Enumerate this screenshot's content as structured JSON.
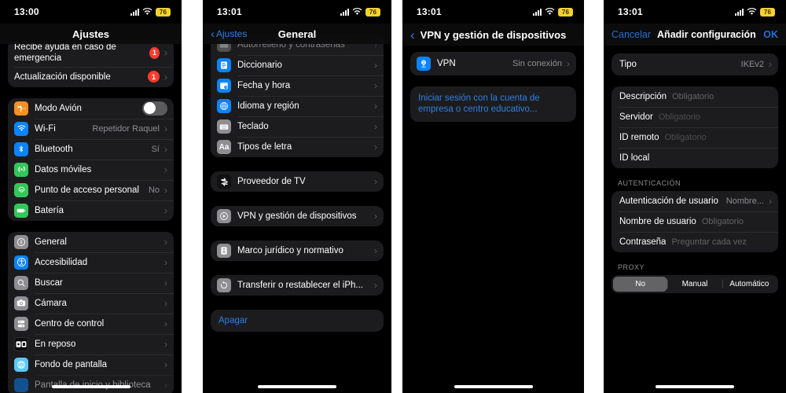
{
  "meta": {
    "accent_blue": "#2f7fe0",
    "badge_red": "#ff3b30",
    "group_bg": "#1c1c1e",
    "secondary_text": "#8e8e93"
  },
  "panel1": {
    "status": {
      "time": "13:00",
      "battery": "76"
    },
    "nav": {
      "title": "Ajustes"
    },
    "groups": [
      {
        "rows": [
          {
            "label": "Recibe ayuda en caso de emergencia",
            "badge": "1",
            "chevron": "›",
            "icon": "none",
            "wrap": true
          },
          {
            "label": "Actualización disponible",
            "badge": "1",
            "chevron": "›",
            "icon": "none"
          }
        ]
      },
      {
        "rows": [
          {
            "label": "Modo Avión",
            "icon": "airplane-icon",
            "icon_color": "#f59023",
            "toggle": "off"
          },
          {
            "label": "Wi-Fi",
            "icon": "wifi-icon",
            "icon_color": "#0a84ff",
            "value": "Repetidor Raquel",
            "chevron": "›"
          },
          {
            "label": "Bluetooth",
            "icon": "bluetooth-icon",
            "icon_color": "#0a84ff",
            "value": "Sí",
            "chevron": "›"
          },
          {
            "label": "Datos móviles",
            "icon": "cellular-icon",
            "icon_color": "#34c759",
            "chevron": "›"
          },
          {
            "label": "Punto de acceso personal",
            "icon": "hotspot-icon",
            "icon_color": "#34c759",
            "value": "No",
            "chevron": "›"
          },
          {
            "label": "Batería",
            "icon": "battery-icon",
            "icon_color": "#34c759",
            "chevron": "›"
          }
        ]
      },
      {
        "rows": [
          {
            "label": "General",
            "icon": "gear-icon",
            "icon_color": "#8e8e93",
            "chevron": "›"
          },
          {
            "label": "Accesibilidad",
            "icon": "accessibility-icon",
            "icon_color": "#0a84ff",
            "chevron": "›"
          },
          {
            "label": "Buscar",
            "icon": "search-icon",
            "icon_color": "#8e8e93",
            "chevron": "›"
          },
          {
            "label": "Cámara",
            "icon": "camera-icon",
            "icon_color": "#8e8e93",
            "chevron": "›"
          },
          {
            "label": "Centro de control",
            "icon": "control-center-icon",
            "icon_color": "#8e8e93",
            "chevron": "›"
          },
          {
            "label": "En reposo",
            "icon": "standby-icon",
            "icon_color": "#1c1c1e",
            "chevron": "›"
          },
          {
            "label": "Fondo de pantalla",
            "icon": "wallpaper-icon",
            "icon_color": "#5ac8fa",
            "chevron": "›"
          },
          {
            "label": "Pantalla de inicio y biblioteca",
            "icon": "home-screen-icon",
            "icon_color": "#0a84ff",
            "chevron": "›",
            "cut": true
          }
        ]
      }
    ]
  },
  "panel2": {
    "status": {
      "time": "13:01",
      "battery": "76"
    },
    "nav": {
      "back": "Ajustes",
      "title": "General"
    },
    "groups": [
      {
        "rows": [
          {
            "label": "Autorrelleno y contraseñas",
            "icon": "keyboard-autofill-icon",
            "icon_color": "#8e8e93",
            "chevron": "›",
            "cut_top": true
          },
          {
            "label": "Diccionario",
            "icon": "dictionary-icon",
            "icon_color": "#0a84ff",
            "chevron": "›"
          },
          {
            "label": "Fecha y hora",
            "icon": "date-time-icon",
            "icon_color": "#0a84ff",
            "chevron": "›"
          },
          {
            "label": "Idioma y región",
            "icon": "language-region-icon",
            "icon_color": "#0a84ff",
            "chevron": "›"
          },
          {
            "label": "Teclado",
            "icon": "keyboard-icon",
            "icon_color": "#8e8e93",
            "chevron": "›"
          },
          {
            "label": "Tipos de letra",
            "icon": "fonts-icon",
            "icon_color": "#8e8e93",
            "chevron": "›"
          }
        ]
      },
      {
        "rows": [
          {
            "label": "Proveedor de TV",
            "icon": "tv-provider-icon",
            "icon_color": "#1c1c1e",
            "chevron": "›"
          }
        ]
      },
      {
        "rows": [
          {
            "label": "VPN y gestión de dispositivos",
            "icon": "vpn-device-icon",
            "icon_color": "#8e8e93",
            "chevron": "›"
          }
        ]
      },
      {
        "rows": [
          {
            "label": "Marco jurídico y normativo",
            "icon": "legal-icon",
            "icon_color": "#8e8e93",
            "chevron": "›"
          }
        ]
      },
      {
        "rows": [
          {
            "label": "Transferir o restablecer el iPh...",
            "icon": "reset-icon",
            "icon_color": "#8e8e93",
            "chevron": "›"
          }
        ]
      },
      {
        "rows": [
          {
            "label": "Apagar",
            "icon": "none",
            "blue": true
          }
        ]
      }
    ]
  },
  "panel3": {
    "status": {
      "time": "13:01",
      "battery": "76"
    },
    "nav": {
      "title": "VPN y gestión de dispositivos"
    },
    "groups": [
      {
        "rows": [
          {
            "label": "VPN",
            "icon": "vpn-globe-icon",
            "icon_color": "#0a84ff",
            "value": "Sin conexión",
            "chevron": "›"
          }
        ]
      },
      {
        "rows": [
          {
            "label": "Iniciar sesión con la cuenta de empresa o centro educativo...",
            "icon": "none",
            "blue": true,
            "wrap": true
          }
        ]
      }
    ]
  },
  "panel4": {
    "status": {
      "time": "13:01",
      "battery": "76"
    },
    "nav": {
      "cancel": "Cancelar",
      "title": "Añadir configuración",
      "ok": "OK"
    },
    "groups": [
      {
        "rows": [
          {
            "label": "Tipo",
            "value": "IKEv2",
            "chevron": "›",
            "icon": "none"
          }
        ]
      },
      {
        "rows": [
          {
            "label": "Descripción",
            "placeholder": "Obligatorio",
            "icon": "none"
          },
          {
            "label": "Servidor",
            "placeholder": "Obligatorio",
            "icon": "none"
          },
          {
            "label": "ID remoto",
            "placeholder": "Obligatorio",
            "icon": "none"
          },
          {
            "label": "ID local",
            "placeholder": "",
            "icon": "none"
          }
        ]
      }
    ],
    "auth": {
      "header": "AUTENTICACIÓN",
      "rows": [
        {
          "label": "Autenticación de usuario",
          "value": "Nombre...",
          "chevron": "›",
          "icon": "none"
        },
        {
          "label": "Nombre de usuario",
          "placeholder": "Obligatorio",
          "icon": "none"
        },
        {
          "label": "Contraseña",
          "placeholder": "Preguntar cada vez",
          "icon": "none"
        }
      ]
    },
    "proxy": {
      "header": "PROXY",
      "options": [
        "No",
        "Manual",
        "Automático"
      ],
      "selected": "No"
    }
  }
}
